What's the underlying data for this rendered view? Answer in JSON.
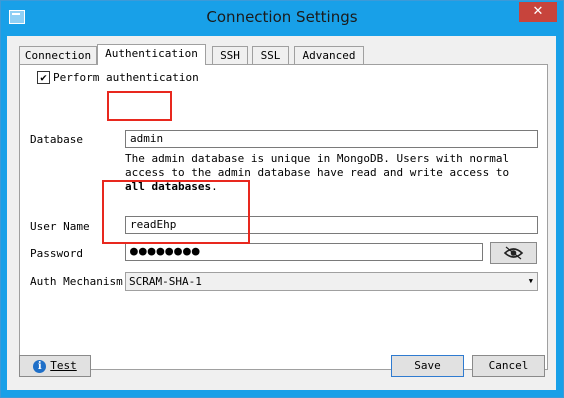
{
  "window": {
    "title": "Connection Settings",
    "close_glyph": "✕"
  },
  "tabs": [
    {
      "label": "Connection"
    },
    {
      "label": "Authentication"
    },
    {
      "label": "SSH"
    },
    {
      "label": "SSL"
    },
    {
      "label": "Advanced"
    }
  ],
  "auth": {
    "perform_label": "Perform authentication",
    "perform_checked": true,
    "database_label": "Database",
    "database_value": "admin",
    "description_part1": "The admin database is unique in MongoDB. Users with normal access to the admin database have read and write access to ",
    "description_bold": "all databases",
    "description_end": ".",
    "username_label": "User Name",
    "username_value": "readEhp",
    "password_label": "Password",
    "password_mask": "●●●●●●●●",
    "mechanism_label": "Auth Mechanism",
    "mechanism_value": "SCRAM-SHA-1"
  },
  "buttons": {
    "test_label": "Test",
    "save_label": "Save",
    "cancel_label": "Cancel"
  },
  "colors": {
    "titlebar": "#18a0e8",
    "highlight": "#e8281e",
    "close": "#c7443c"
  }
}
